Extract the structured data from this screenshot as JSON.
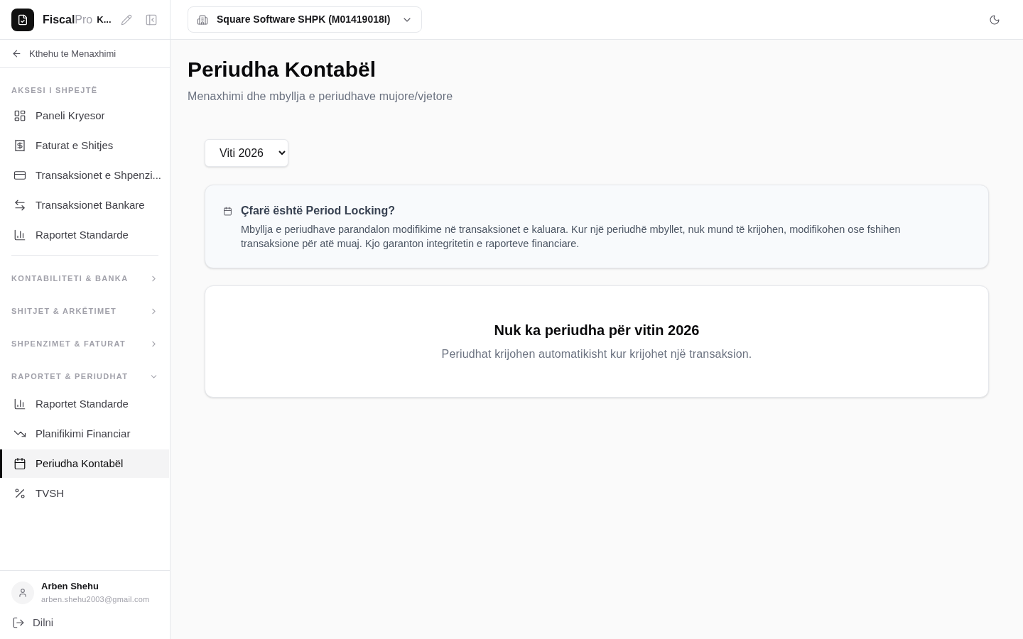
{
  "sidebar": {
    "brand": {
      "name": "Fiscal",
      "suffix": "Pro",
      "company": "K..."
    },
    "back_link": "Kthehu te Menaxhimi",
    "quick_access": {
      "title": "AKSESI I SHPEJTË",
      "items": [
        {
          "label": "Paneli Kryesor",
          "selected": false
        },
        {
          "label": "Faturat e Shitjes",
          "selected": false
        },
        {
          "label": "Transaksionet e Shpenzi...",
          "selected": false
        },
        {
          "label": "Transaksionet Bankare",
          "selected": false
        },
        {
          "label": "Raportet Standarde",
          "selected": false
        }
      ]
    },
    "groups": [
      {
        "title": "KONTABILITETI & BANKA",
        "expanded": false
      },
      {
        "title": "SHITJET & ARKËTIMET",
        "expanded": false
      },
      {
        "title": "SHPENZIMET & FATURAT",
        "expanded": false
      },
      {
        "title": "RAPORTET & PERIUDHAT",
        "expanded": true,
        "items": [
          {
            "label": "Raportet Standarde",
            "selected": false
          },
          {
            "label": "Planifikimi Financiar",
            "selected": false
          },
          {
            "label": "Periudha Kontabël",
            "selected": true
          },
          {
            "label": "TVSH",
            "selected": false
          }
        ]
      }
    ],
    "user": {
      "name": "Arben Shehu",
      "email": "arben.shehu2003@gmail.com"
    },
    "logout": "Dilni"
  },
  "header": {
    "company_selector": "Square Software SHPK (M01419018I)"
  },
  "page": {
    "title": "Periudha Kontabël",
    "subtitle": "Menaxhimi dhe mbyllja e periudhave mujore/vjetore",
    "year_select": {
      "value": "Viti 2026"
    },
    "info": {
      "title": "Çfarë është Period Locking?",
      "text": "Mbyllja e periudhave parandalon modifikime në transaksionet e kaluara. Kur një periudhë mbyllet, nuk mund të krijohen, modifikohen ose fshihen transaksione për atë muaj. Kjo garanton integritetin e raporteve financiare."
    },
    "empty_state": {
      "title": "Nuk ka periudha për vitin 2026",
      "text": "Periudhat krijohen automatikisht kur krijohet një transaksion."
    }
  }
}
